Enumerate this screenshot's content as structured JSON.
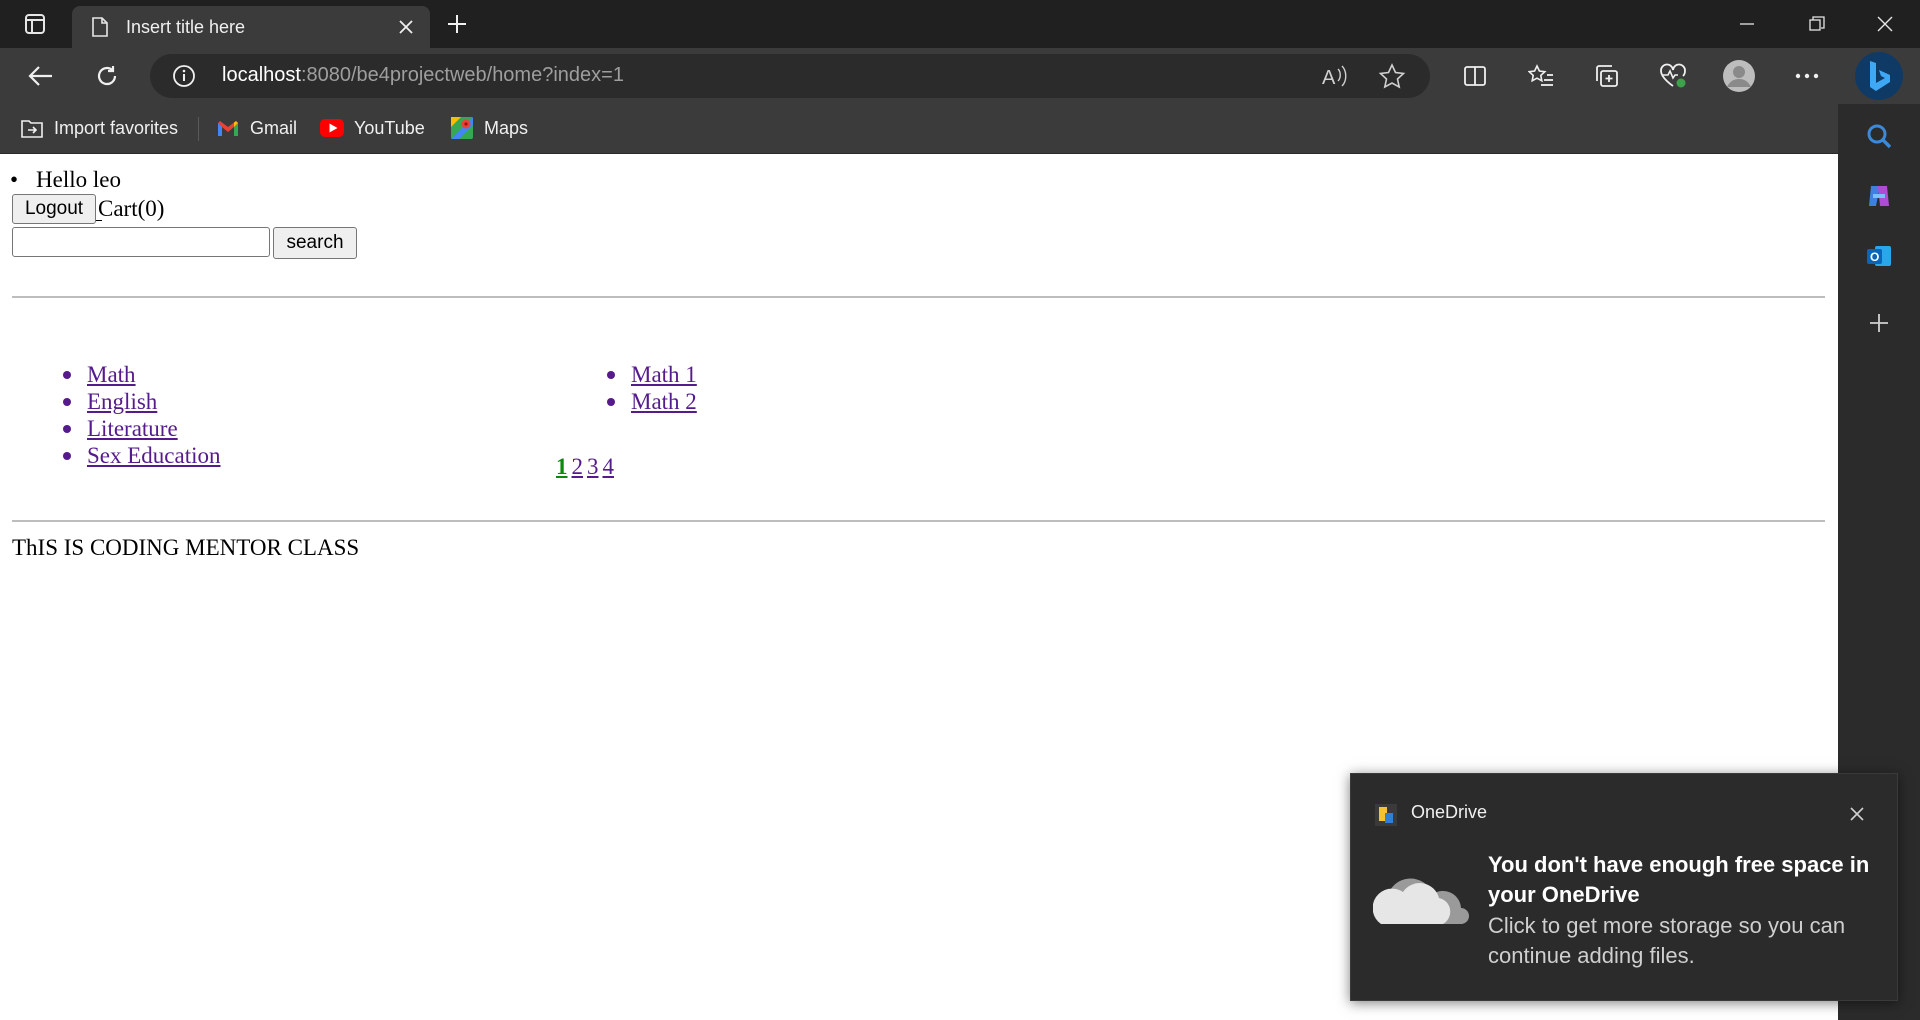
{
  "browser": {
    "tab": {
      "title": "Insert title here"
    },
    "address": {
      "host": "localhost",
      "rest": ":8080/be4projectweb/home?index=1"
    },
    "favorites": [
      {
        "label": "Import favorites",
        "icon": "import-favorites-icon"
      },
      {
        "label": "Gmail",
        "icon": "gmail-icon"
      },
      {
        "label": "YouTube",
        "icon": "youtube-icon"
      },
      {
        "label": "Maps",
        "icon": "maps-icon"
      }
    ]
  },
  "page": {
    "greeting": "Hello leo",
    "logout_label": "Logout",
    "cart_label": "Cart(0)",
    "search": {
      "value": "",
      "button_label": "search"
    },
    "categories": [
      "Math",
      "English",
      "Literature",
      "Sex Education"
    ],
    "products": [
      "Math 1",
      "Math 2"
    ],
    "pagination": [
      "1",
      "2",
      "3",
      "4"
    ],
    "active_page": "1",
    "footer": "ThIS IS CODING MENTOR CLASS"
  },
  "toast": {
    "app_name": "OneDrive",
    "headline": "You don't have enough free space in your OneDrive",
    "body": "Click to get more storage so you can continue adding files."
  },
  "colors": {
    "link": "#551a8b",
    "active_page": "#0b8a0b",
    "titlebar": "#202020",
    "toolbar": "#3b3b3b"
  }
}
